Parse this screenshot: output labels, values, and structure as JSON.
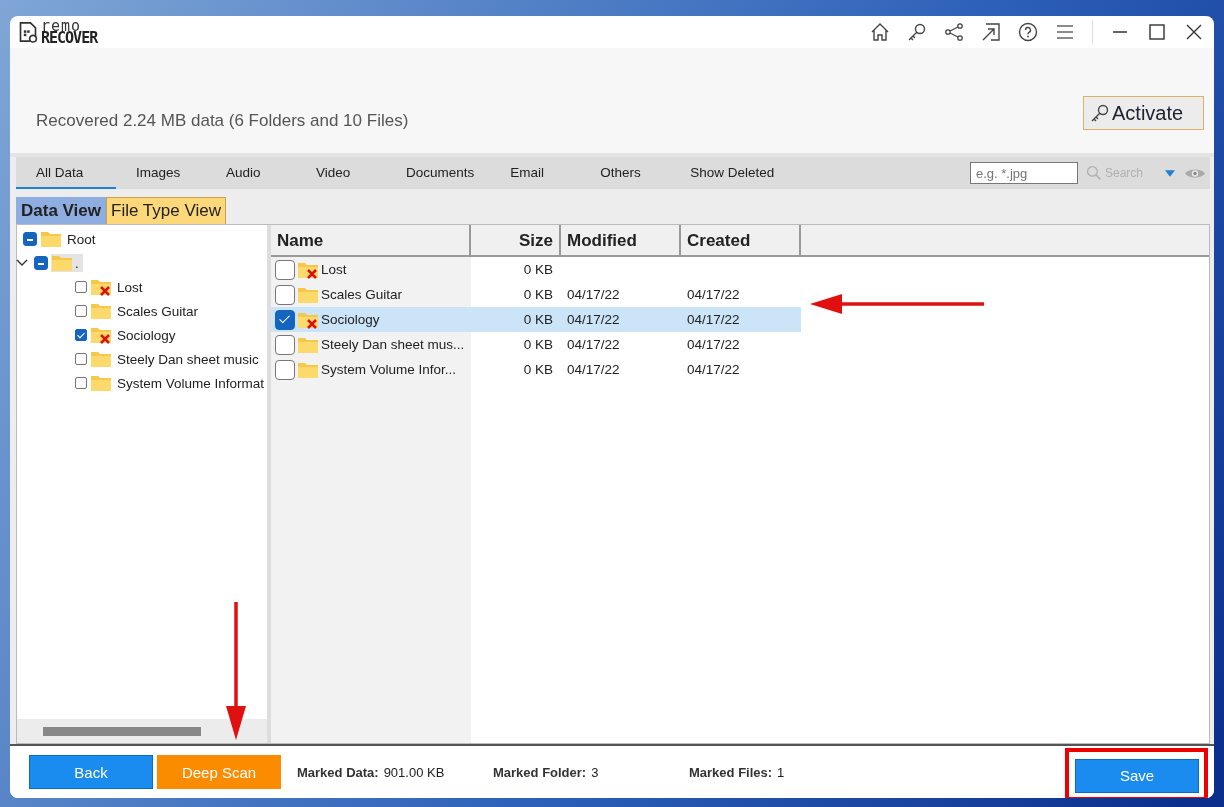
{
  "logo": {
    "line_1": "remo",
    "line_2": "RECOVER"
  },
  "summary": "Recovered 2.24 MB data (6 Folders and 10 Files)",
  "activate_button": "Activate",
  "filter_tabs": [
    {
      "label": "All Data",
      "selected": true
    },
    {
      "label": "Images",
      "selected": false
    },
    {
      "label": "Audio",
      "selected": false
    },
    {
      "label": "Video",
      "selected": false
    },
    {
      "label": "Documents",
      "selected": false
    },
    {
      "label": "Email",
      "selected": false
    },
    {
      "label": "Others",
      "selected": false
    },
    {
      "label": "Show Deleted",
      "selected": false
    }
  ],
  "search": {
    "placeholder": "e.g. *.jpg",
    "button": "Search",
    "disabled": true
  },
  "view_tabs": [
    {
      "label": "Data View",
      "selected": true
    },
    {
      "label": "File Type View",
      "selected": false
    }
  ],
  "tree": [
    {
      "label": "Root",
      "partial": true,
      "children": [
        {
          "label": ".",
          "partial": true,
          "expanded": true,
          "children": [
            {
              "label": "Lost",
              "checked": false,
              "deleted": true
            },
            {
              "label": "Scales Guitar",
              "checked": false,
              "deleted": false
            },
            {
              "label": "Sociology",
              "checked": true,
              "deleted": true
            },
            {
              "label": "Steely Dan sheet music",
              "checked": false,
              "deleted": false
            },
            {
              "label": "System Volume Informat",
              "checked": false,
              "deleted": false
            }
          ]
        }
      ]
    }
  ],
  "table": {
    "columns": [
      "Name",
      "Size",
      "Modified",
      "Created"
    ],
    "rows": [
      {
        "name": "Lost",
        "size": "0 KB",
        "checked": false,
        "deleted": true,
        "selected": false
      },
      {
        "name": "Scales Guitar",
        "size": "0 KB",
        "modified": "04/17/22",
        "created": "04/17/22",
        "checked": false,
        "deleted": false,
        "selected": false
      },
      {
        "name": "Sociology",
        "size": "0 KB",
        "modified": "04/17/22",
        "created": "04/17/22",
        "checked": true,
        "deleted": true,
        "selected": true
      },
      {
        "name": "Steely Dan sheet mus...",
        "size": "0 KB",
        "modified": "04/17/22",
        "created": "04/17/22",
        "checked": false,
        "deleted": false,
        "selected": false
      },
      {
        "name": "System Volume Infor...",
        "size": "0 KB",
        "modified": "04/17/22",
        "created": "04/17/22",
        "checked": false,
        "deleted": false,
        "selected": false
      }
    ]
  },
  "footer": {
    "back_button": "Back",
    "deep_scan_button": "Deep Scan",
    "stats": [
      {
        "label": "Marked Data:",
        "value": "901.00 KB"
      },
      {
        "label": "Marked Folder:",
        "value": "3"
      },
      {
        "label": "Marked Files:",
        "value": "1"
      }
    ],
    "save_button": "Save"
  }
}
